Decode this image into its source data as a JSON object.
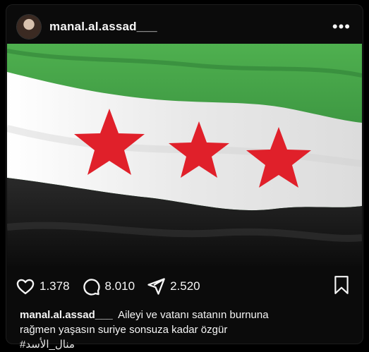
{
  "post": {
    "username": "manal.al.assad___",
    "more_icon": "more-horizontal-icon",
    "image": {
      "subject": "flag",
      "colors": {
        "green": "#2f8f3a",
        "white": "#f4f4f4",
        "black": "#121212",
        "star_red": "#e0202a"
      }
    },
    "actions": {
      "likes": "1.378",
      "comments": "8.010",
      "shares": "2.520"
    },
    "caption": {
      "username": "manal.al.assad___",
      "text_line1": "Aileyi ve vatanı satanın burnuna",
      "text_line2": "rağmen yaşasın suriye sonsuza kadar özgür",
      "hashtag": "#منال_الأسد"
    }
  }
}
